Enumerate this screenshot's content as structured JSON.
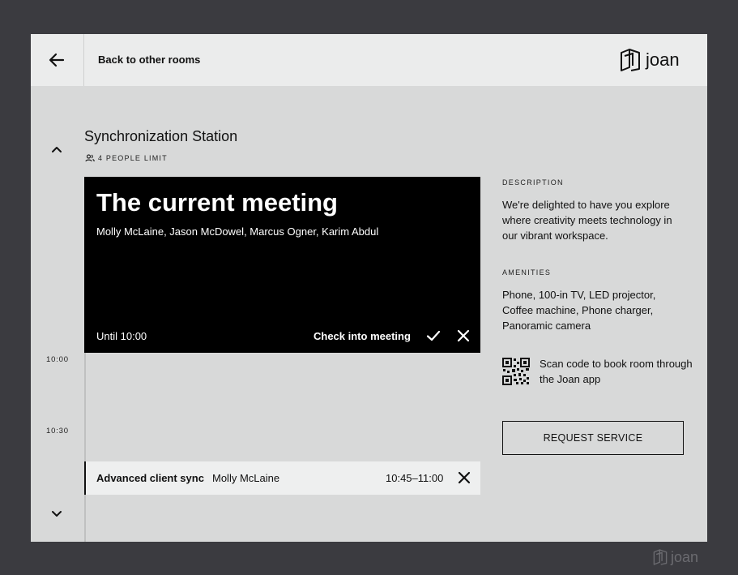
{
  "header": {
    "back_label": "Back to other rooms",
    "brand_name": "joan"
  },
  "room": {
    "name": "Synchronization Station",
    "capacity": "4 PEOPLE LIMIT"
  },
  "current_meeting": {
    "title": "The current meeting",
    "attendees": "Molly McLaine, Jason McDowel, Marcus Ogner, Karim Abdul",
    "until": "Until 10:00",
    "checkin_label": "Check into meeting"
  },
  "timeline": {
    "times": [
      "10:00",
      "10:30"
    ]
  },
  "upcoming_meeting": {
    "title": "Advanced client sync",
    "host": "Molly McLaine",
    "time": "10:45–11:00"
  },
  "details": {
    "description_label": "DESCRIPTION",
    "description_text": "We're delighted to have you explore where creativity meets technology in our vibrant workspace.",
    "amenities_label": "AMENITIES",
    "amenities_text": "Phone, 100-in TV, LED projector, Coffee machine, Phone charger, Panoramic camera",
    "qr_text": "Scan code to book room through the Joan app",
    "request_button": "REQUEST SERVICE"
  },
  "device": {
    "bezel_brand": "joan"
  },
  "colors": {
    "bezel": "#3b3b40",
    "screen": "#d8d9d9",
    "topbar": "#ebecec",
    "meeting_card": "#000000"
  }
}
